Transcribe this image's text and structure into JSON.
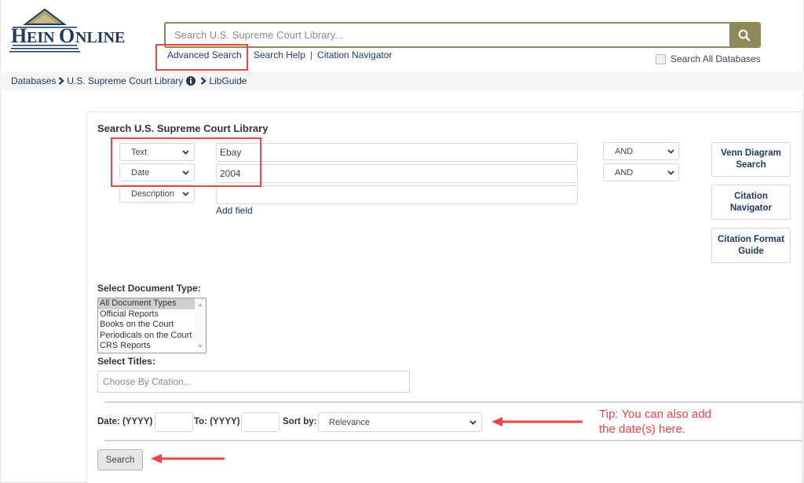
{
  "header": {
    "logo_text": "HeinOnline",
    "search": {
      "placeholder": "Search U.S. Supreme Court Library...",
      "value": "",
      "button_icon": "search-icon"
    },
    "links": [
      {
        "label": "Advanced Search"
      },
      {
        "label": "Search Help"
      },
      {
        "label": "Citation Navigator"
      }
    ],
    "link_separator": "|",
    "search_all_databases": {
      "label": "Search All Databases",
      "checked": false
    }
  },
  "breadcrumb": {
    "items": [
      {
        "label": "Databases"
      },
      {
        "label": "U.S. Supreme Court Library"
      },
      {
        "label": "LibGuide"
      }
    ],
    "info_icon": "info-circle-icon",
    "separator_icon": "chevron-right-icon"
  },
  "advanced_search": {
    "title": "Search U.S. Supreme Court Library",
    "rows": [
      {
        "field": "Text",
        "value": "Ebay",
        "operator": "AND"
      },
      {
        "field": "Date",
        "value": "2004",
        "operator": "AND"
      },
      {
        "field": "Description",
        "value": "",
        "operator": null
      }
    ],
    "add_field_label": "Add field",
    "side_buttons": [
      {
        "label": "Venn Diagram Search"
      },
      {
        "label": "Citation Navigator"
      },
      {
        "label": "Citation Format Guide"
      }
    ],
    "document_type": {
      "label": "Select Document Type:",
      "options": [
        "All Document Types",
        "Official Reports",
        "Books on the Court",
        "Periodicals on the Court",
        "CRS Reports"
      ],
      "selected": "All Document Types"
    },
    "titles": {
      "label": "Select Titles:",
      "placeholder": "Choose By Citation..."
    },
    "date_range": {
      "from_label": "Date: (YYYY)",
      "from_value": "",
      "to_label": "To: (YYYY)",
      "to_value": "",
      "sort_label": "Sort by:",
      "sort_value": "Relevance"
    },
    "search_button_label": "Search"
  },
  "annotations": {
    "tip_text_line1": "Tip: You can also add",
    "tip_text_line2": "the date(s) here.",
    "color": "#ef4444"
  },
  "colors": {
    "brand_olive": "#8e8a58",
    "link_navy": "#1f3a62",
    "annotation_red": "#ef4444"
  }
}
